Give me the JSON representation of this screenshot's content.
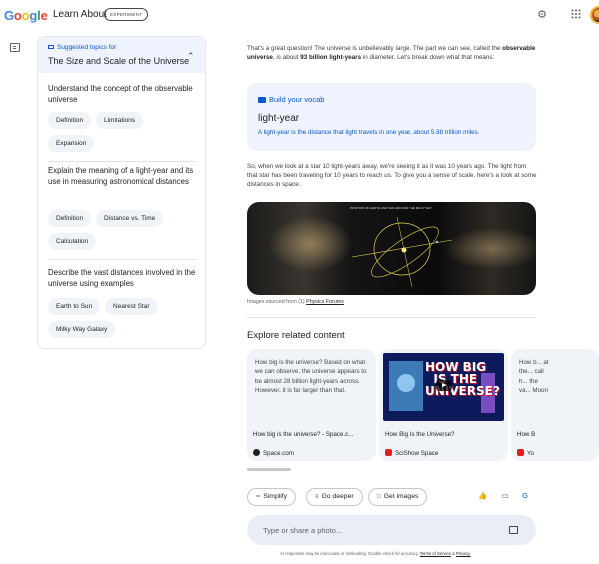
{
  "header": {
    "logo": "Google",
    "app_title": "Learn About",
    "badge": "EXPERIMENT"
  },
  "topics": {
    "subtitle": "Suggested topics for",
    "title": "The Size and Scale of the Universe",
    "groups": [
      {
        "question": "Understand the concept of the observable universe",
        "chips": [
          "Definition",
          "Limitations",
          "Expansion"
        ]
      },
      {
        "question": "Explain the meaning of a light-year and its use in measuring astronomical distances",
        "chips": [
          "Definition",
          "Distance vs. Time",
          "Calculation"
        ]
      },
      {
        "question": "Describe the vast distances involved in the universe using examples",
        "chips": [
          "Earth to Sun",
          "Nearest Star",
          "Milky Way Galaxy"
        ]
      }
    ]
  },
  "main": {
    "intro_pre": "That's a great question! The universe is unbelievably large. The part we can see, called the ",
    "intro_bold1": "observable universe",
    "intro_mid": ", is about ",
    "intro_bold2": "93 billion light-years",
    "intro_post": " in diameter. Let's break down what that means:",
    "vocab": {
      "heading": "Build your vocab",
      "term": "light-year",
      "definition": "A light-year is the distance that light travels in one year, about 5.88 trillion miles."
    },
    "para2": "So, when we look at a star 10 light-years away, we're seeing it as it was 10 years ago. The light from that star has been traveling for 10 years to reach us. To give you a sense of scale, here's a look at some distances in space.",
    "image_caption_prefix": "Images sourced from (1) ",
    "image_caption_link": "Physics Forums",
    "image_title_text": "POSITION OF EARTH AND SUN AROUND THE MILKY WAY"
  },
  "related": {
    "title": "Explore related content",
    "cards": [
      {
        "text": "How big is the universe? Based on what we can observe, the universe appears to be almost 28 billion light-years across. However, it is far larger than that.",
        "title": "How big is the universe? - Space.c...",
        "source": "Space.com"
      },
      {
        "thumb_text": "HOW BIG\n  IS THE\nUNIVERSE?",
        "title": "How Big Is the Universe?",
        "source": "SciShow Space"
      },
      {
        "text": "How b... at the... call h... the va... Moon",
        "title": "How B",
        "source": "Yo"
      }
    ]
  },
  "actions": {
    "simplify": "Simplify",
    "go_deeper": "Go deeper",
    "get_images": "Get images"
  },
  "prompt": {
    "placeholder": "Type or share a photo..."
  },
  "footer": {
    "note": "AI responses may be inaccurate or misleading. Double-check for accuracy.",
    "tos": "Terms of Service",
    "privacy": "Privacy."
  },
  "colors": {
    "accent": "#0b57d0",
    "chip_bg": "#f0f4f9",
    "vocab_bg": "#eef3fd"
  }
}
